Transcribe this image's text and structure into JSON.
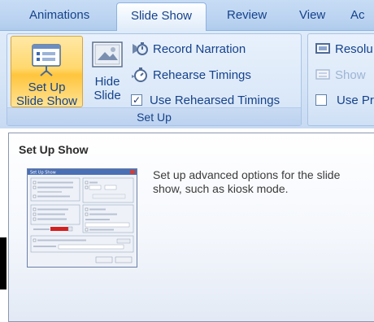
{
  "tabs": [
    {
      "label": "Animations",
      "active": false
    },
    {
      "label": "Slide Show",
      "active": true
    },
    {
      "label": "Review",
      "active": false
    },
    {
      "label": "View",
      "active": false
    },
    {
      "label": "Ac",
      "active": false
    }
  ],
  "setup_group": {
    "label": "Set Up",
    "setup_show": {
      "line1": "Set Up",
      "line2": "Slide Show",
      "icon": "setup-show-icon"
    },
    "hide_slide": {
      "line1": "Hide",
      "line2": "Slide",
      "icon": "hide-slide-icon"
    },
    "record_narration": {
      "label": "Record Narration",
      "icon": "microphone-icon"
    },
    "rehearse_timings": {
      "label": "Rehearse Timings",
      "icon": "stopwatch-icon"
    },
    "use_rehearsed_timings": {
      "label": "Use Rehearsed Timings",
      "checked": true
    }
  },
  "monitors_group": {
    "resolution": {
      "label": "Resolu",
      "icon": "monitor-icon"
    },
    "show_on": {
      "label": "Show",
      "icon": "show-on-icon",
      "disabled": true
    },
    "use_presenter_view": {
      "label": "Use Pr",
      "checked": false
    }
  },
  "tooltip": {
    "title": "Set Up Show",
    "description": "Set up advanced options for the slide show, such as kiosk mode.",
    "thumbnail_title": "Set Up Show"
  },
  "colors": {
    "ribbon_text": "#15428b",
    "active_button": "#ffd86e",
    "tooltip_text": "#3b3b3b"
  }
}
